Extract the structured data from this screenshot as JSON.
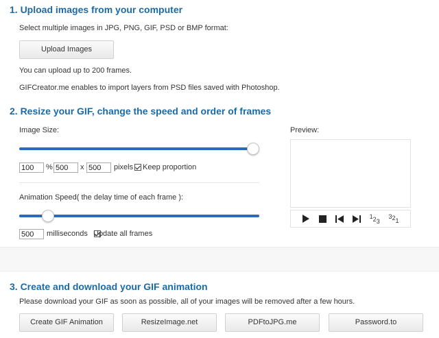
{
  "section1": {
    "heading": "1. Upload images from your computer",
    "formats_text": "Select multiple images in JPG, PNG, GIF, PSD or BMP format:",
    "upload_button": "Upload Images",
    "limit_text": "You can upload up to 200 frames.",
    "psd_text": "GIFCreator.me enables to import layers from PSD files saved with Photoshop."
  },
  "section2": {
    "heading": "2. Resize your GIF, change the speed and order of frames",
    "image_size_label": "Image Size:",
    "size_slider_fraction": 1.0,
    "percent_value": "100",
    "percent_sign": "%",
    "width_value": "500",
    "times_sign": "x",
    "height_value": "500",
    "pixels_label": "pixels",
    "keep_proportion_label": "Keep proportion",
    "keep_proportion_checked": true,
    "speed_label": "Animation Speed( the delay time of each frame ):",
    "speed_slider_fraction": 0.1,
    "speed_value": "500",
    "milliseconds_label": "milliseconds",
    "update_all_label": "Update all frames",
    "update_all_checked": true,
    "preview_label": "Preview:",
    "order_asc_label": "123",
    "order_desc_label": "321"
  },
  "section3": {
    "heading": "3. Create and download your GIF animation",
    "notice_text": "Please download your GIF as soon as possible, all of your images will be removed after a few hours.",
    "buttons": [
      "Create GIF Animation",
      "ResizeImage.net",
      "PDFtoJPG.me",
      "Password.to"
    ]
  },
  "colors": {
    "heading": "#1b6aa5",
    "slider_fill": "#2a6bbd",
    "slider_track": "#d4d4d4"
  }
}
